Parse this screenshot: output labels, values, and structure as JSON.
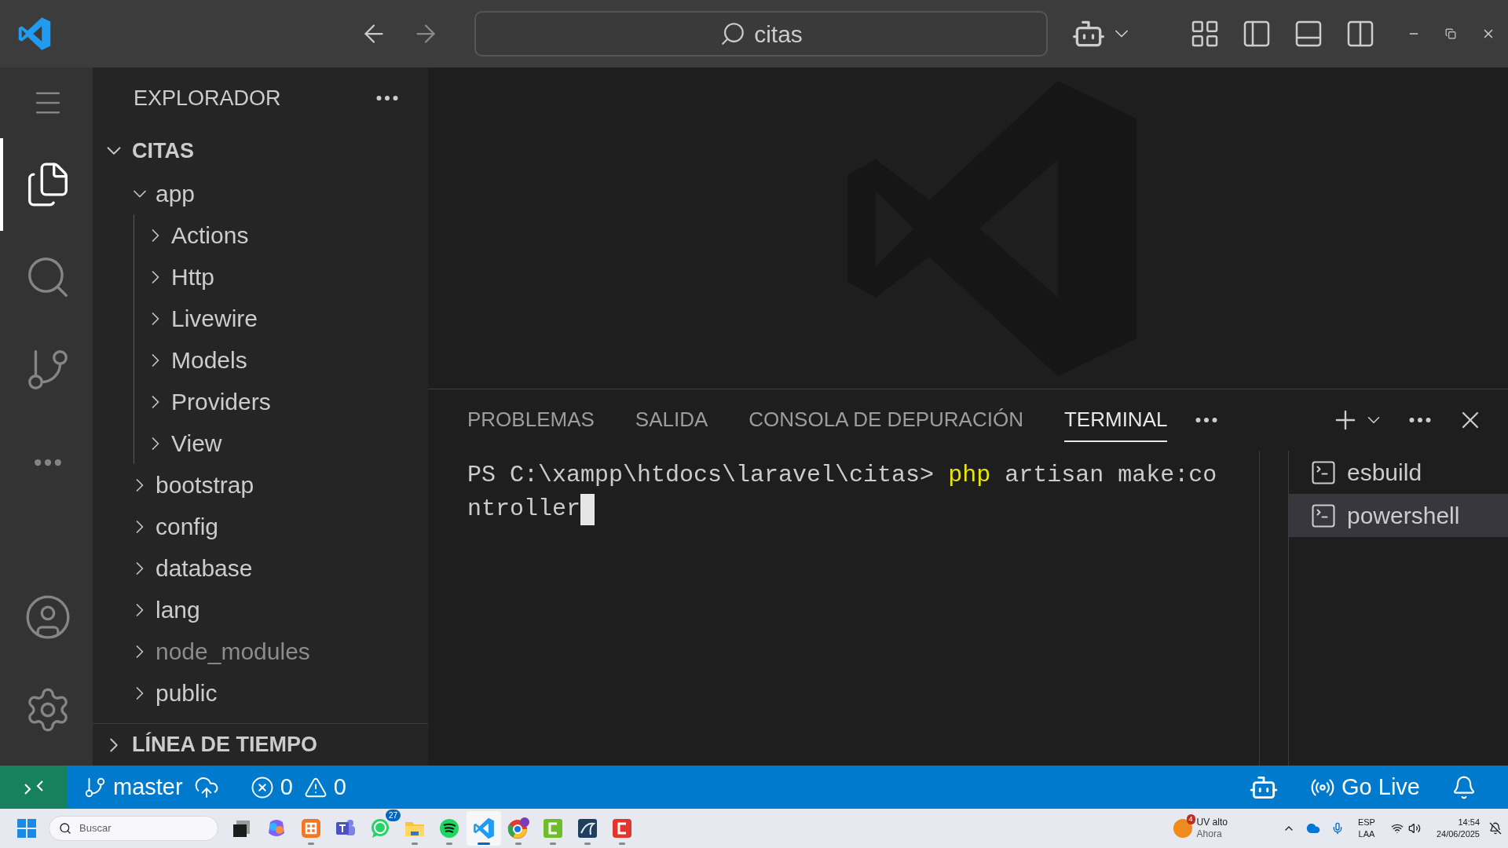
{
  "title_bar": {
    "search": "citas"
  },
  "activity_bar": [
    {
      "kind": "menu",
      "selected": false
    },
    {
      "kind": "explorer",
      "selected": true
    },
    {
      "kind": "search",
      "selected": false
    },
    {
      "kind": "source-control",
      "selected": false
    },
    {
      "kind": "more",
      "selected": false
    },
    {
      "kind": "account",
      "selected": false
    },
    {
      "kind": "settings",
      "selected": false
    }
  ],
  "explorer": {
    "title": "EXPLORADOR",
    "section": {
      "label": "CITAS",
      "expanded": true
    },
    "tree": [
      {
        "label": "app",
        "expanded": true,
        "children": [
          {
            "label": "Actions",
            "expanded": false
          },
          {
            "label": "Http",
            "expanded": false
          },
          {
            "label": "Livewire",
            "expanded": false
          },
          {
            "label": "Models",
            "expanded": false
          },
          {
            "label": "Providers",
            "expanded": false
          },
          {
            "label": "View",
            "expanded": false
          }
        ]
      },
      {
        "label": "bootstrap",
        "expanded": false
      },
      {
        "label": "config",
        "expanded": false
      },
      {
        "label": "database",
        "expanded": false
      },
      {
        "label": "lang",
        "expanded": false
      },
      {
        "label": "node_modules",
        "expanded": false,
        "ignored": true
      },
      {
        "label": "public",
        "expanded": false
      }
    ]
  },
  "timeline": {
    "label": "LÍNEA DE TIEMPO",
    "expanded": false
  },
  "panel": {
    "tabs": [
      {
        "label": "PROBLEMAS",
        "selected": false
      },
      {
        "label": "SALIDA",
        "selected": false
      },
      {
        "label": "CONSOLA DE DEPURACIÓN",
        "selected": false
      },
      {
        "label": "TERMINAL",
        "selected": true
      }
    ],
    "terminal": {
      "prompt": "PS C:\\xampp\\htdocs\\laravel\\citas>",
      "command": "php",
      "args": "artisan make:co",
      "continuation": "ntroller"
    },
    "sessions": [
      {
        "label": "esbuild",
        "selected": false
      },
      {
        "label": "powershell",
        "selected": true
      }
    ]
  },
  "status_bar": {
    "branch": "master",
    "errors": "0",
    "warnings": "0",
    "go_live": "Go Live"
  },
  "taskbar": {
    "search_placeholder": "Buscar",
    "apps": [
      {
        "kind": "task-view",
        "running": false,
        "active": false
      },
      {
        "kind": "copilot",
        "running": false,
        "active": false
      },
      {
        "kind": "xampp",
        "running": true,
        "active": false
      },
      {
        "kind": "teams",
        "running": false,
        "active": false
      },
      {
        "kind": "whatsapp",
        "running": false,
        "active": false,
        "badge": "27"
      },
      {
        "kind": "files",
        "running": true,
        "active": false
      },
      {
        "kind": "spotify",
        "running": true,
        "active": false
      },
      {
        "kind": "vscode",
        "running": true,
        "active": true
      },
      {
        "kind": "chrome",
        "running": true,
        "active": false
      },
      {
        "kind": "green-app",
        "running": true,
        "active": false
      },
      {
        "kind": "mysql",
        "running": true,
        "active": false
      },
      {
        "kind": "red-app",
        "running": true,
        "active": false
      }
    ],
    "weather": {
      "badge": "4",
      "title": "UV alto",
      "subtitle": "Ahora"
    },
    "language": {
      "top": "ESP",
      "bottom": "LAA"
    },
    "clock": {
      "time": "14:54",
      "date": "24/06/2025"
    }
  }
}
